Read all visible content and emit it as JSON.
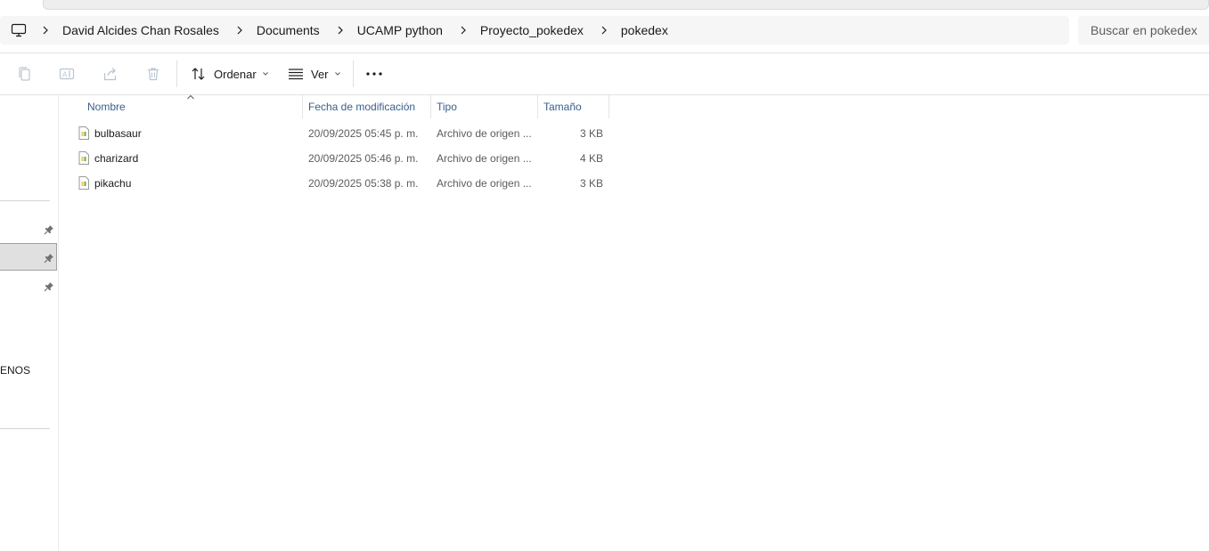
{
  "breadcrumb": {
    "items": [
      {
        "label": "David Alcides Chan Rosales"
      },
      {
        "label": "Documents"
      },
      {
        "label": "UCAMP python"
      },
      {
        "label": "Proyecto_pokedex"
      },
      {
        "label": "pokedex"
      }
    ]
  },
  "search": {
    "placeholder": "Buscar en pokedex"
  },
  "toolbar": {
    "copy_icon": "copy-icon",
    "rename_icon": "rename-icon",
    "share_icon": "share-icon",
    "delete_icon": "trash-icon",
    "sort_label": "Ordenar",
    "view_label": "Ver",
    "more_label": "..."
  },
  "nav_pane": {
    "partial_label": "ENOS"
  },
  "file_list": {
    "columns": [
      {
        "label": "Nombre"
      },
      {
        "label": "Fecha de modificación"
      },
      {
        "label": "Tipo"
      },
      {
        "label": "Tamaño"
      }
    ],
    "sorted_column": "Nombre",
    "rows": [
      {
        "name": "bulbasaur",
        "modified": "20/09/2025 05:45 p. m.",
        "type": "Archivo de origen ...",
        "size": "3 KB"
      },
      {
        "name": "charizard",
        "modified": "20/09/2025 05:46 p. m.",
        "type": "Archivo de origen ...",
        "size": "4 KB"
      },
      {
        "name": "pikachu",
        "modified": "20/09/2025 05:38 p. m.",
        "type": "Archivo de origen ...",
        "size": "3 KB"
      }
    ]
  },
  "colors": {
    "header_text": "#3a5f8a",
    "secondary_text": "#5c5c5c",
    "selection_bg": "#e0e0e0"
  }
}
